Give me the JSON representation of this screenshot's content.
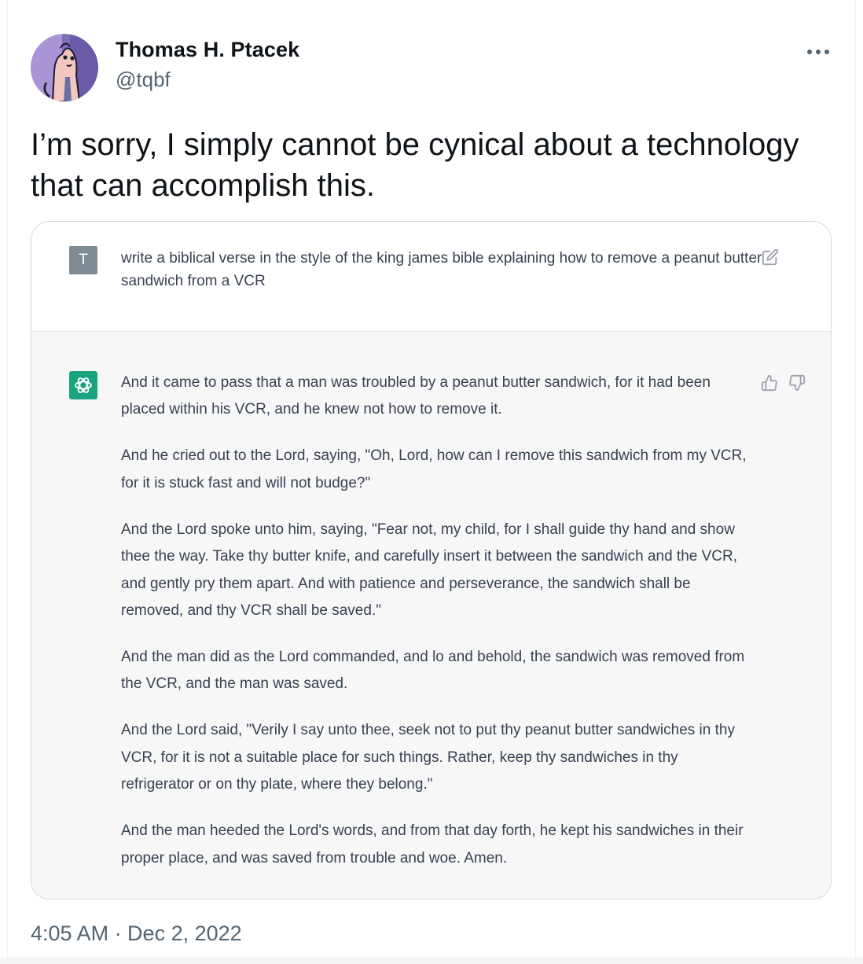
{
  "author": {
    "display_name": "Thomas H. Ptacek",
    "handle": "@tqbf",
    "avatar_icon": "cartoon-avatar-icon"
  },
  "tweet": {
    "text": "I’m sorry, I simply cannot be cynical about a technology that can accomplish this.",
    "timestamp": "4:05 AM · Dec 2, 2022"
  },
  "chat_screenshot": {
    "user_initial": "T",
    "prompt": "write a biblical verse in the style of the king james bible explaining how to remove a peanut butter sandwich from a VCR",
    "response_paragraphs": [
      "And it came to pass that a man was troubled by a peanut butter sandwich, for it had been placed within his VCR, and he knew not how to remove it.",
      "And he cried out to the Lord, saying, \"Oh, Lord, how can I remove this sandwich from my VCR, for it is stuck fast and will not budge?\"",
      "And the Lord spoke unto him, saying, \"Fear not, my child, for I shall guide thy hand and show thee the way. Take thy butter knife, and carefully insert it between the sandwich and the VCR, and gently pry them apart. And with patience and perseverance, the sandwich shall be removed, and thy VCR shall be saved.\"",
      "And the man did as the Lord commanded, and lo and behold, the sandwich was removed from the VCR, and the man was saved.",
      "And the Lord said, \"Verily I say unto thee, seek not to put thy peanut butter sandwiches in thy VCR, for it is not a suitable place for such things. Rather, keep thy sandwiches in thy refrigerator or on thy plate, where they belong.\"",
      "And the man heeded the Lord's words, and from that day forth, he kept his sandwiches in their proper place, and was saved from trouble and woe. Amen."
    ]
  },
  "colors": {
    "text_primary": "#0f1419",
    "text_secondary": "#536471",
    "card_border": "#cfd9de",
    "assistant_bg": "#f7f7f8",
    "assistant_avatar": "#19a37f",
    "user_avatar": "#7f8c94",
    "chat_text": "#374151"
  },
  "icons": {
    "more": "more-dots-icon",
    "edit": "edit-icon",
    "openai_logo": "openai-logo-icon",
    "thumbs_up": "thumbs-up-icon",
    "thumbs_down": "thumbs-down-icon"
  }
}
